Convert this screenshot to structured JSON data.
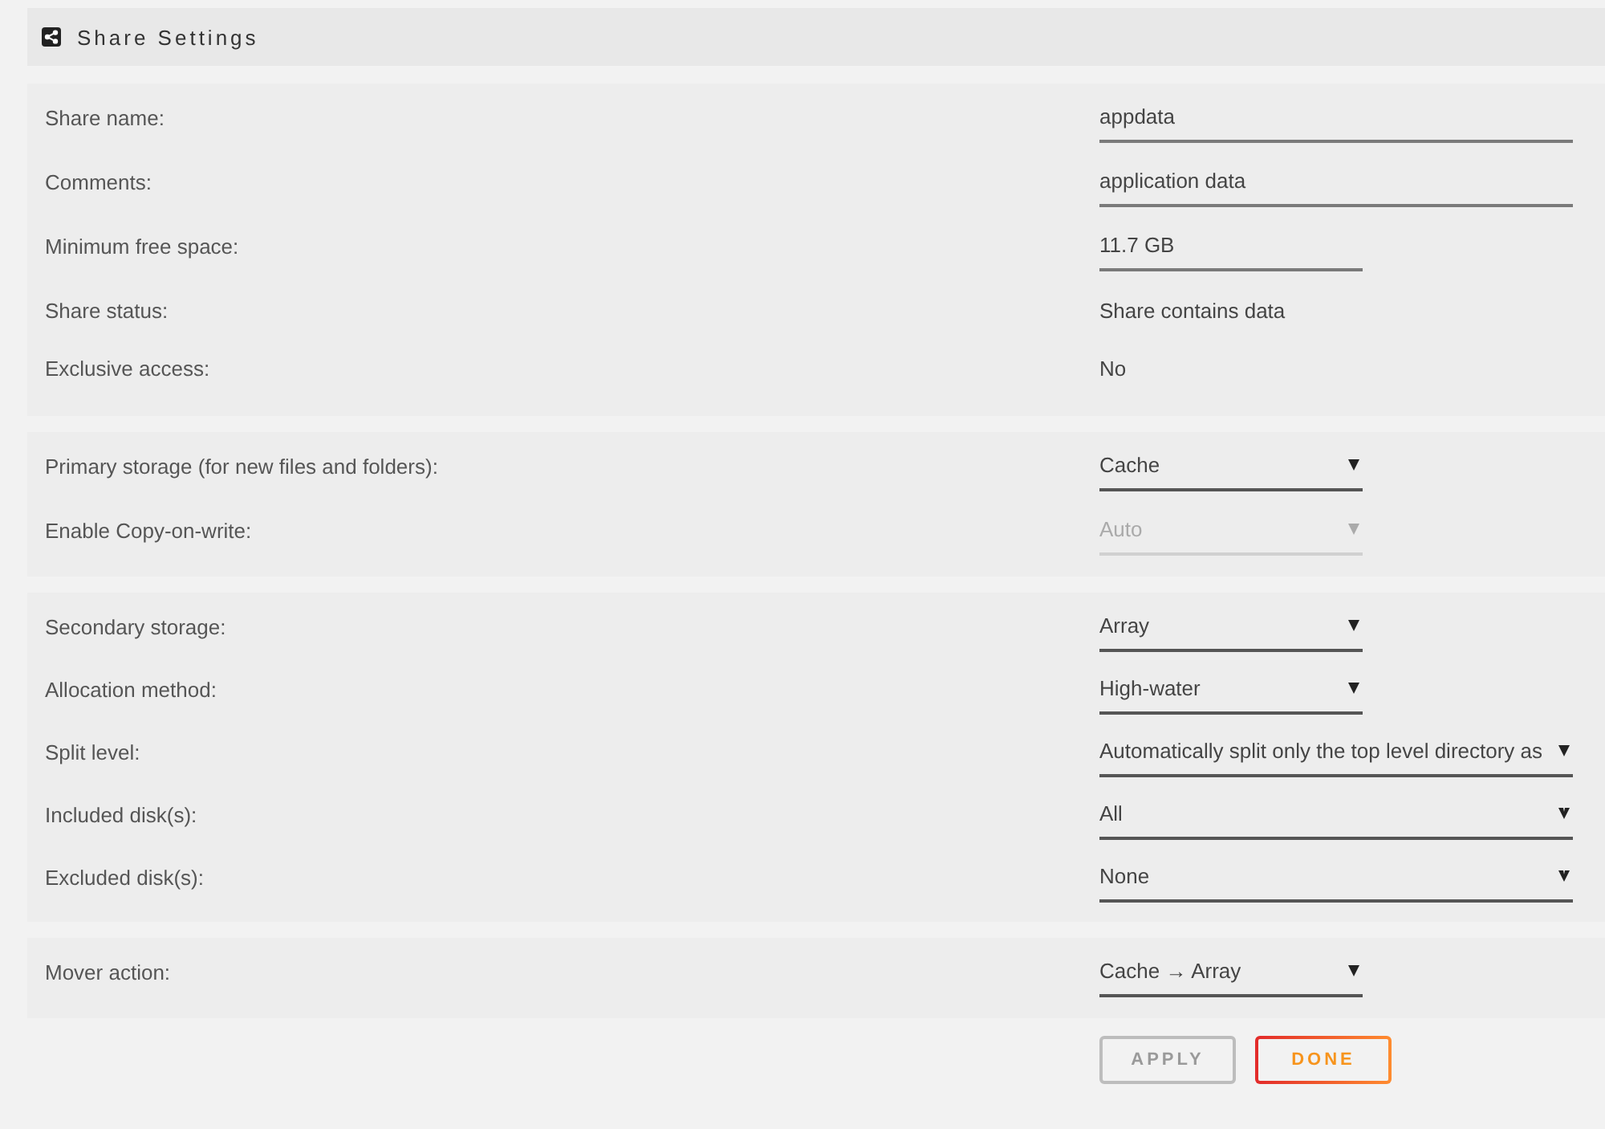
{
  "header": {
    "title": "Share Settings"
  },
  "sections": [
    {
      "rows": [
        {
          "kind": "input",
          "label": "Share name:",
          "value": "appdata",
          "disabled": false
        },
        {
          "kind": "input",
          "label": "Comments:",
          "value": "application data",
          "disabled": false
        },
        {
          "kind": "input",
          "label": "Minimum free space:",
          "value": "11.7 GB",
          "disabled": false
        },
        {
          "kind": "text",
          "label": "Share status:",
          "value": "Share contains data"
        },
        {
          "kind": "text",
          "label": "Exclusive access:",
          "value": "No"
        }
      ]
    },
    {
      "rows": [
        {
          "kind": "select",
          "label": "Primary storage (for new files and folders):",
          "value": "Cache",
          "disabled": false
        },
        {
          "kind": "select",
          "label": "Enable Copy-on-write:",
          "value": "Auto",
          "disabled": true
        }
      ]
    },
    {
      "rows": [
        {
          "kind": "select",
          "label": "Secondary storage:",
          "value": "Array",
          "disabled": false
        },
        {
          "kind": "select",
          "label": "Allocation method:",
          "value": "High-water",
          "disabled": false
        },
        {
          "kind": "select",
          "label": "Split level:",
          "value": "Automatically split only the top level directory as",
          "disabled": false
        },
        {
          "kind": "multiselect",
          "label": "Included disk(s):",
          "value": "All",
          "disabled": false
        },
        {
          "kind": "multiselect",
          "label": "Excluded disk(s):",
          "value": "None",
          "disabled": false
        }
      ]
    },
    {
      "rows": [
        {
          "kind": "select",
          "label": "Mover action:",
          "value": "Cache → Array",
          "disabled": false
        }
      ]
    }
  ],
  "buttons": [
    {
      "label": "APPLY",
      "disabled": true
    },
    {
      "label": "DONE",
      "disabled": false
    }
  ]
}
